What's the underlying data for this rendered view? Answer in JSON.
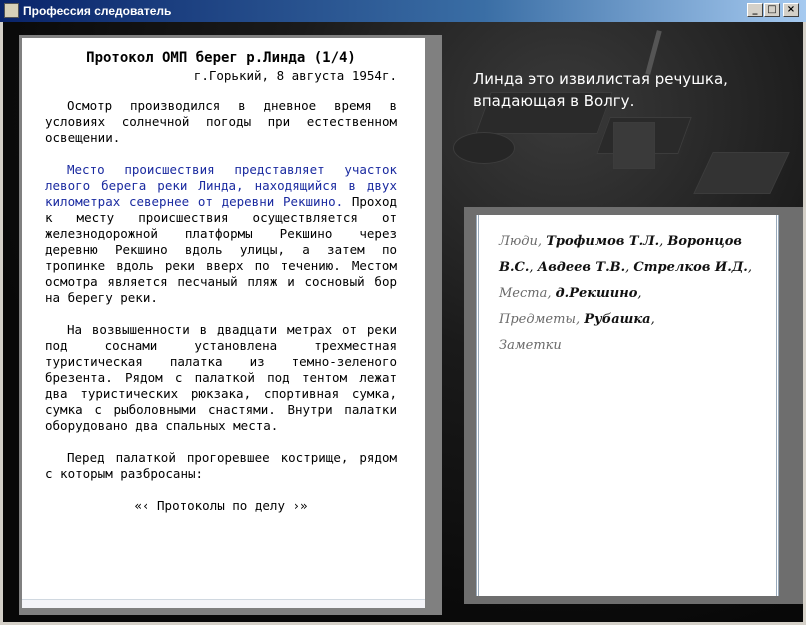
{
  "window": {
    "title": "Профессия следователь",
    "buttons": {
      "minimize": "_",
      "maximize": "□",
      "close": "×"
    }
  },
  "document": {
    "title": "Протокол ОМП берег р.Линда (1/4)",
    "date": "г.Горький, 8 августа 1954г.",
    "p1": "Осмотр производился в дневное время в условиях солнечной погоды при естественном освещении.",
    "p2_highlight": "Место происшествия представляет участок левого берега реки Линда, находящийся в двух километрах севернее от деревни Рекшино.",
    "p2_rest": " Проход к месту происшествия осуществляется от железнодорожной платформы Рекшино через деревню Рекшино вдоль улицы, а затем по тропинке вдоль реки вверх по течению. Местом осмотра является песчаный пляж и сосновый бор на берегу реки.",
    "p3": "На возвышенности в двадцати метрах от реки под соснами установлена трехместная туристическая палатка из темно-зеленого брезента. Рядом с палаткой под тентом лежат два туристических рюкзака, спортивная сумка, сумка с рыболовными снастями. Внутри палатки оборудовано два спальных места.",
    "p4": "Перед палаткой прогоревшее кострище, рядом с которым разбросаны:",
    "footer": "«‹ Протоколы по делу ›»"
  },
  "narration": {
    "line1": "Линда это извилистая речушка,",
    "line2": "впадающая в Волгу."
  },
  "notebook": {
    "people_label": "Люди,",
    "people": [
      "Трофимов Т.Л.",
      "Воронцов В.С.",
      "Авдеев Т.В.",
      "Стрелков И.Д."
    ],
    "places_label": "Места,",
    "places": [
      "д.Рекшино"
    ],
    "items_label": "Предметы,",
    "items": [
      "Рубашка"
    ],
    "notes_label": "Заметки"
  }
}
